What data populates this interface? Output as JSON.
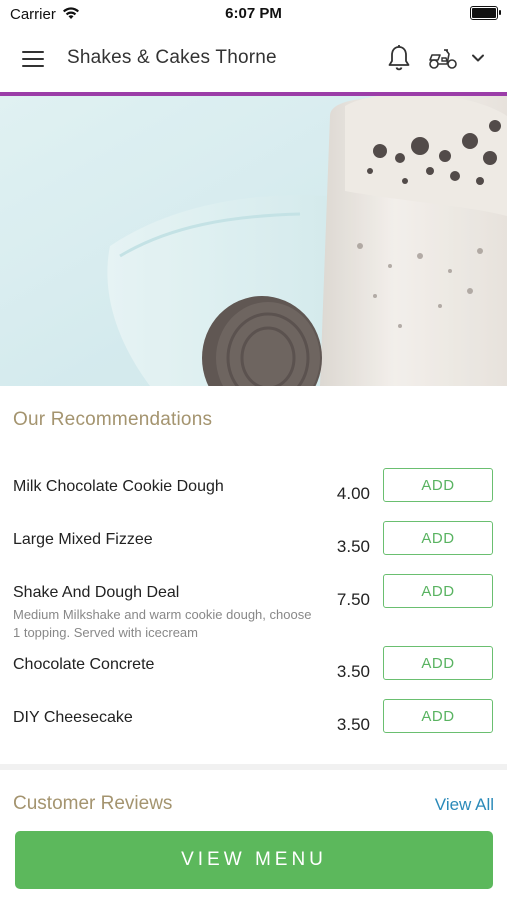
{
  "status_bar": {
    "carrier": "Carrier",
    "time": "6:07 PM"
  },
  "header": {
    "title": "Shakes & Cakes Thorne",
    "icons": [
      "menu-icon",
      "bell-icon",
      "scooter-icon",
      "chevron-down-icon"
    ],
    "accent_color": "#9b3da8"
  },
  "hero": {
    "image": "cookies and cream milkshake with oreo cookie"
  },
  "recommendations": {
    "title": "Our Recommendations",
    "items": [
      {
        "name": "Milk Chocolate Cookie Dough",
        "description": "",
        "price": "4.00",
        "action": "ADD"
      },
      {
        "name": "Large Mixed Fizzee",
        "description": "",
        "price": "3.50",
        "action": "ADD"
      },
      {
        "name": "Shake And Dough Deal",
        "description": "Medium Milkshake and warm cookie dough, choose 1 topping. Served with icecream",
        "price": "7.50",
        "action": "ADD"
      },
      {
        "name": "Chocolate Concrete",
        "description": "",
        "price": "3.50",
        "action": "ADD"
      },
      {
        "name": "DIY Cheesecake",
        "description": "",
        "price": "3.50",
        "action": "ADD"
      }
    ]
  },
  "reviews": {
    "title": "Customer Reviews",
    "link": "View All"
  },
  "footer": {
    "button": "VIEW MENU",
    "button_color": "#5cb85c"
  }
}
